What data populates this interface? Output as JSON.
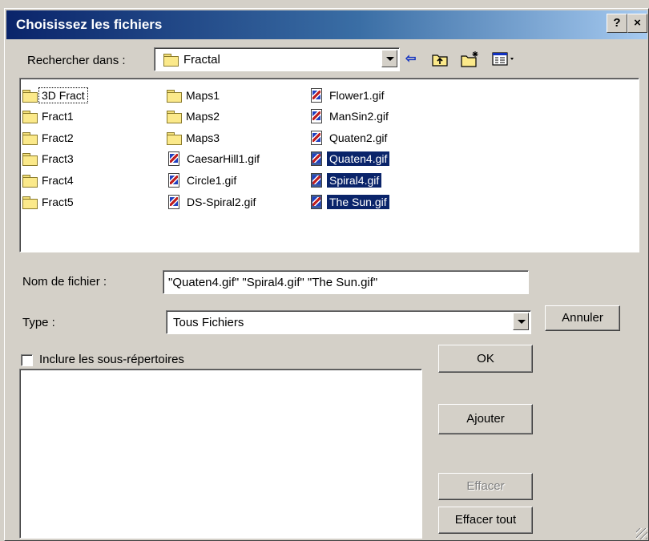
{
  "window": {
    "title": "Choisissez les fichiers",
    "help_button": "?",
    "close_button": "×"
  },
  "lookin": {
    "label": "Rechercher dans :",
    "value": "Fractal"
  },
  "toolbar": {
    "back_icon": "arrow-left",
    "up_icon": "folder-up",
    "new_folder_icon": "new-folder",
    "view_menu_icon": "view-details"
  },
  "files": {
    "col1": [
      "3D Fract",
      "Fract1",
      "Fract2",
      "Fract3",
      "Fract4",
      "Fract5"
    ],
    "col2_folders": [
      "Maps1",
      "Maps2",
      "Maps3"
    ],
    "col2_files": [
      "CaesarHill1.gif",
      "Circle1.gif",
      "DS-Spiral2.gif"
    ],
    "col3": [
      "Flower1.gif",
      "ManSin2.gif",
      "Quaten2.gif",
      "Quaten4.gif",
      "Spiral4.gif",
      "The Sun.gif"
    ],
    "selected": [
      "Quaten4.gif",
      "Spiral4.gif",
      "The Sun.gif"
    ]
  },
  "filename": {
    "label": "Nom de fichier :",
    "value": "\"Quaten4.gif\" \"Spiral4.gif\" \"The Sun.gif\""
  },
  "type": {
    "label": "Type :",
    "value": "Tous Fichiers"
  },
  "subdirs": {
    "label": "Inclure les sous-répertoires",
    "checked": false
  },
  "buttons": {
    "cancel": "Annuler",
    "ok": "OK",
    "add": "Ajouter",
    "remove": "Effacer",
    "remove_all": "Effacer tout"
  },
  "colors": {
    "selection": "#0a246a",
    "face": "#d4d0c8"
  }
}
